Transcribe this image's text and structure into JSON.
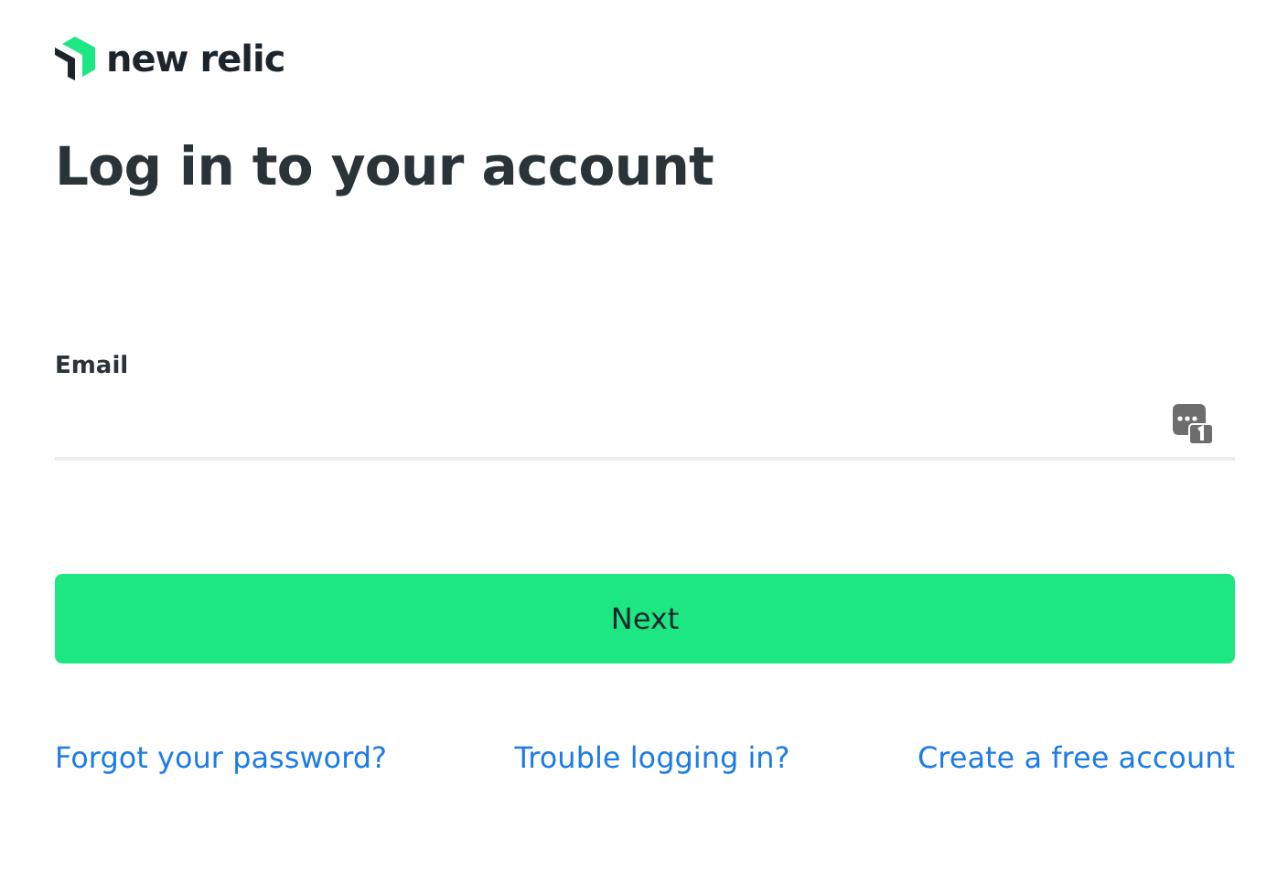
{
  "logo": {
    "text": "new relic"
  },
  "heading": "Log in to your account",
  "email": {
    "label": "Email"
  },
  "next_button": "Next",
  "links": [
    "Forgot your password?",
    "Trouble logging in?",
    "Create a free account"
  ]
}
